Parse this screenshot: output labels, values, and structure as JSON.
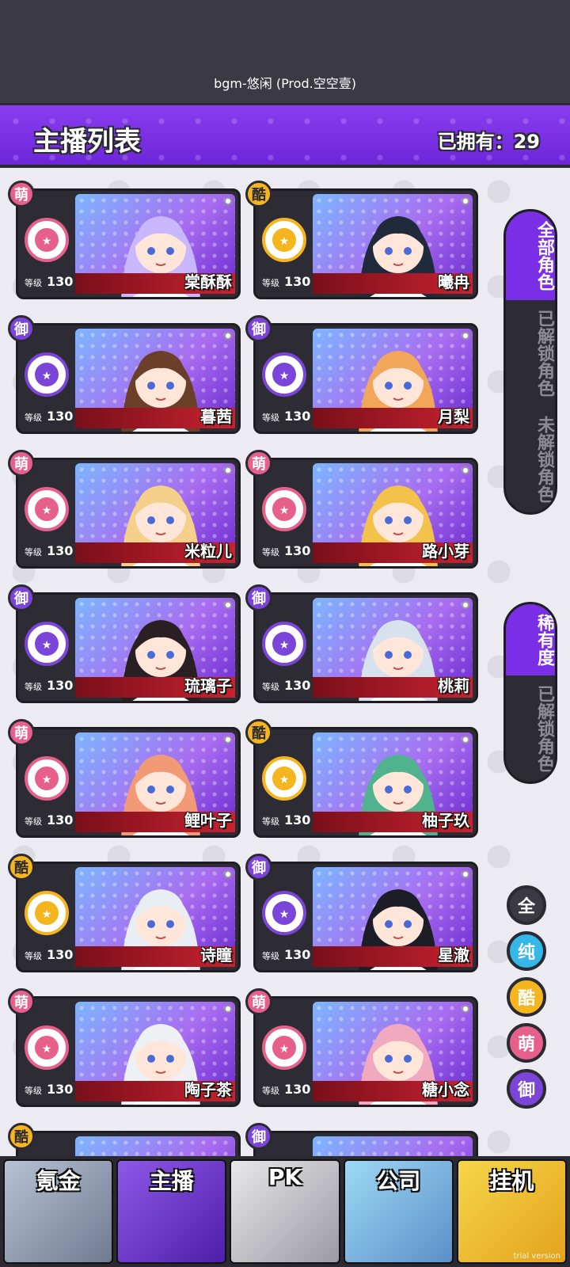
{
  "status_bar": {
    "bgm": "bgm-悠闲 (Prod.空空壹)"
  },
  "header": {
    "title": "主播列表",
    "owned": "已拥有：29"
  },
  "level_label": "等级",
  "cards": [
    {
      "name": "棠酥酥",
      "tag": "萌",
      "level": "130",
      "tag_color": "#e7608c"
    },
    {
      "name": "曦冉",
      "tag": "酷",
      "level": "130",
      "tag_color": "#f4b51e"
    },
    {
      "name": "暮茜",
      "tag": "御",
      "level": "130",
      "tag_color": "#7a45d8"
    },
    {
      "name": "月梨",
      "tag": "御",
      "level": "130",
      "tag_color": "#7a45d8"
    },
    {
      "name": "米粒儿",
      "tag": "萌",
      "level": "130",
      "tag_color": "#e7608c"
    },
    {
      "name": "路小芽",
      "tag": "萌",
      "level": "130",
      "tag_color": "#e7608c"
    },
    {
      "name": "琉璃子",
      "tag": "御",
      "level": "130",
      "tag_color": "#7a45d8"
    },
    {
      "name": "桃莉",
      "tag": "御",
      "level": "130",
      "tag_color": "#7a45d8"
    },
    {
      "name": "鲤叶子",
      "tag": "萌",
      "level": "130",
      "tag_color": "#e7608c"
    },
    {
      "name": "柚子玖",
      "tag": "酷",
      "level": "130",
      "tag_color": "#f4b51e"
    },
    {
      "name": "诗瞳",
      "tag": "酷",
      "level": "130",
      "tag_color": "#f4b51e"
    },
    {
      "name": "星澈",
      "tag": "御",
      "level": "130",
      "tag_color": "#7a45d8"
    },
    {
      "name": "陶子茶",
      "tag": "萌",
      "level": "130",
      "tag_color": "#e7608c"
    },
    {
      "name": "糖小念",
      "tag": "萌",
      "level": "130",
      "tag_color": "#e7608c"
    }
  ],
  "partial_tags": [
    "酷",
    "御"
  ],
  "sidebar_group1": [
    "全部角色",
    "已解锁角色",
    "未解锁角色"
  ],
  "sidebar_group2": [
    "稀有度",
    "已解锁角色"
  ],
  "filters": [
    {
      "label": "全",
      "color": "#3a3944"
    },
    {
      "label": "纯",
      "color": "#35b7e8"
    },
    {
      "label": "酷",
      "color": "#f4b51e"
    },
    {
      "label": "萌",
      "color": "#e7608c"
    },
    {
      "label": "御",
      "color": "#7a45d8"
    }
  ],
  "nav": [
    "氪金",
    "主播",
    "PK",
    "公司",
    "挂机"
  ],
  "trial": "trial version",
  "colors": {
    "accent": "#7a2ee6",
    "dark": "#2b2a33"
  }
}
